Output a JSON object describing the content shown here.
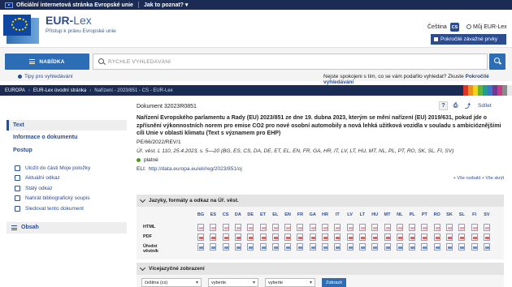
{
  "topbar": {
    "official": "Oficiální internetová stránka Evropské unie",
    "how_to_know": "Jak to poznat? ▾"
  },
  "header": {
    "brand_eur": "EUR-",
    "brand_lex": "Lex",
    "tagline": "Přístup k právu Evropské unie",
    "language": "Čeština",
    "language_code": "CS",
    "my_eurlex": "Můj EUR-Lex",
    "advanced_search": "Pokročilé závažné prvky"
  },
  "search": {
    "menu_label": "NABÍDKA",
    "placeholder": "RYCHLÉ VYHLEDÁVÁNÍ",
    "tips": "Tipy pro vyhledávání",
    "satisfaction_text": "Nejste spokojeni s tím, co se vám podařilo vyhledat? Zkuste ",
    "satisfaction_link": "Pokročilé vyhledávání"
  },
  "breadcrumb": [
    "EUROPA",
    "EUR-Lex úvodní stránka",
    "Nařízení - 2023/851 - CS - EUR-Lex"
  ],
  "stripe_colors": [
    "#e0312b",
    "#f28c1f",
    "#f7d116",
    "#69b32e",
    "#1f9e8a",
    "#3a78c2",
    "#6d3a9c",
    "#c33c87",
    "#8a8a8a",
    "#e9e9e9"
  ],
  "document": {
    "number": "Dokument 32023R0851",
    "share": "Sdílet",
    "title": "Nařízení Evropského parlamentu a Rady (EU) 2023/851 ze dne 19. dubna 2023, kterým se mění nařízení (EU) 2019/631, pokud jde o zpřísnění výkonnostních norem pro emise CO2 pro nové osobní automobily a nová lehká užitková vozidla v souladu s ambicióznějšími cíli Unie v oblasti klimatu (Text s významem pro EHP)",
    "reference": "PE/66/2022/REV/1",
    "oj": "Úř. věst. L 110, 25.4.2023, s. 5—20 (BG, ES, CS, DA, DE, ET, EL, EN, FR, GA, HR, IT, LV, LT, HU, MT, NL, PL, PT, RO, SK, SL, FI, SV)",
    "status": "platné",
    "eli_label": "ELI:",
    "eli_link": "http://data.europa.eu/eli/reg/2023/851/oj",
    "expand_all": "+ Vše rozbalit",
    "collapse_all": "+ Vše skrýt"
  },
  "left_panel": {
    "text": "Text",
    "info": "Informace o dokumentu",
    "procedure": "Postup",
    "links": [
      {
        "label": "Uložit do části Moje položky",
        "icon": "save-icon"
      },
      {
        "label": "Aktuální odkaz",
        "icon": "link-icon"
      },
      {
        "label": "Stálý odkaz",
        "icon": "bookmark-icon"
      },
      {
        "label": "Nahrát bibliografický soupis",
        "icon": "download-icon"
      },
      {
        "label": "Sledovat tento dokument",
        "icon": "rss-icon"
      }
    ],
    "contents": "Obsah"
  },
  "formats": {
    "heading": "Jazyky, formáty a odkaz na Úř. věst.",
    "row_labels": [
      "HTML",
      "PDF",
      "Úřední věstník"
    ],
    "languages": [
      "BG",
      "ES",
      "CS",
      "DA",
      "DE",
      "ET",
      "EL",
      "EN",
      "FR",
      "GA",
      "HR",
      "IT",
      "LV",
      "LT",
      "HU",
      "MT",
      "NL",
      "PL",
      "PT",
      "RO",
      "SK",
      "SL",
      "FI",
      "SV"
    ]
  },
  "multilingual": {
    "heading": "Vícejazyčné zobrazení",
    "select1": "čeština (cs)",
    "select2": "vyberte",
    "select3": "vyberte",
    "button": "Zobrazit"
  }
}
